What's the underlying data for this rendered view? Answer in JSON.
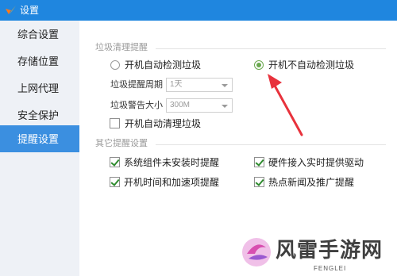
{
  "window": {
    "title": "设置"
  },
  "sidebar": {
    "items": [
      {
        "label": "综合设置",
        "active": false
      },
      {
        "label": "存储位置",
        "active": false
      },
      {
        "label": "上网代理",
        "active": false
      },
      {
        "label": "安全保护",
        "active": false
      },
      {
        "label": "提醒设置",
        "active": true
      }
    ]
  },
  "junk_section": {
    "title": "垃圾清理提醒",
    "radio_auto_detect": {
      "label": "开机自动检测垃圾",
      "checked": false
    },
    "radio_no_auto_detect": {
      "label": "开机不自动检测垃圾",
      "checked": true
    },
    "period": {
      "label": "垃圾提醒周期",
      "value": "1天"
    },
    "warn_size": {
      "label": "垃圾警告大小",
      "value": "300M"
    },
    "auto_clean": {
      "label": "开机自动清理垃圾",
      "checked": false
    }
  },
  "other_section": {
    "title": "其它提醒设置",
    "options": [
      {
        "label": "系统组件未安装时提醒",
        "checked": true
      },
      {
        "label": "硬件接入实时提供驱动",
        "checked": true
      },
      {
        "label": "开机时间和加速项提醒",
        "checked": true
      },
      {
        "label": "热点新闻及推广提醒",
        "checked": true
      }
    ]
  },
  "watermark": {
    "name": "风雷手游网",
    "sub": "FENGLEI"
  },
  "colors": {
    "titlebar": "#1f86df",
    "active_item": "#3b8fe0",
    "annotation": "#e8323c",
    "radio_checked": "#6aa84f"
  }
}
